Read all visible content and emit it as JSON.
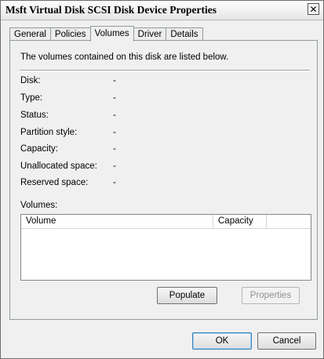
{
  "window": {
    "title": "Msft Virtual Disk SCSI Disk Device Properties",
    "close_glyph": "✕"
  },
  "tabs": [
    {
      "label": "General",
      "active": false
    },
    {
      "label": "Policies",
      "active": false
    },
    {
      "label": "Volumes",
      "active": true
    },
    {
      "label": "Driver",
      "active": false
    },
    {
      "label": "Details",
      "active": false
    }
  ],
  "volumes_tab": {
    "intro": "The volumes contained on this disk are listed below.",
    "properties": [
      {
        "label": "Disk:",
        "value": "-"
      },
      {
        "label": "Type:",
        "value": "-"
      },
      {
        "label": "Status:",
        "value": "-"
      },
      {
        "label": "Partition style:",
        "value": "-"
      },
      {
        "label": "Capacity:",
        "value": "-"
      },
      {
        "label": "Unallocated space:",
        "value": "-"
      },
      {
        "label": "Reserved space:",
        "value": "-"
      }
    ],
    "volumes_label": "Volumes:",
    "columns": [
      "Volume",
      "Capacity"
    ],
    "rows": [],
    "populate_label": "Populate",
    "properties_label": "Properties"
  },
  "footer": {
    "ok_label": "OK",
    "cancel_label": "Cancel"
  }
}
